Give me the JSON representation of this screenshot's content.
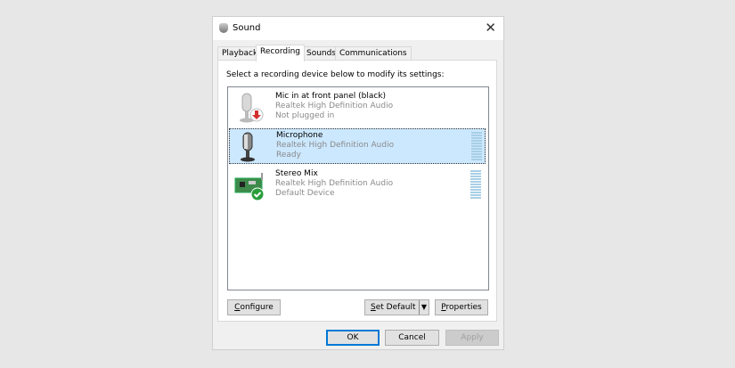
{
  "window": {
    "title": "Sound",
    "close_icon": "close-icon"
  },
  "tabs": [
    {
      "label": "Playback"
    },
    {
      "label": "Recording",
      "active": true
    },
    {
      "label": "Sounds"
    },
    {
      "label": "Communications"
    }
  ],
  "instruction": "Select a recording device below to modify its settings:",
  "devices": [
    {
      "name": "Mic in at front panel (black)",
      "driver": "Realtek High Definition Audio",
      "status": "Not plugged in",
      "icon": "microphone-unplugged-icon"
    },
    {
      "name": "Microphone",
      "driver": "Realtek High Definition Audio",
      "status": "Ready",
      "icon": "microphone-icon",
      "selected": true
    },
    {
      "name": "Stereo Mix",
      "driver": "Realtek High Definition Audio",
      "status": "Default Device",
      "icon": "sound-card-default-icon"
    }
  ],
  "buttons": {
    "configure_u": "C",
    "configure": "onfigure",
    "set_default_u": "S",
    "set_default": "et Default",
    "properties_u": "P",
    "properties": "roperties",
    "ok": "OK",
    "cancel": "Cancel",
    "apply": "Apply"
  },
  "colors": {
    "selection": "#cce8ff",
    "default_check": "#2a9d3a",
    "unplugged": "#d32f2f"
  }
}
